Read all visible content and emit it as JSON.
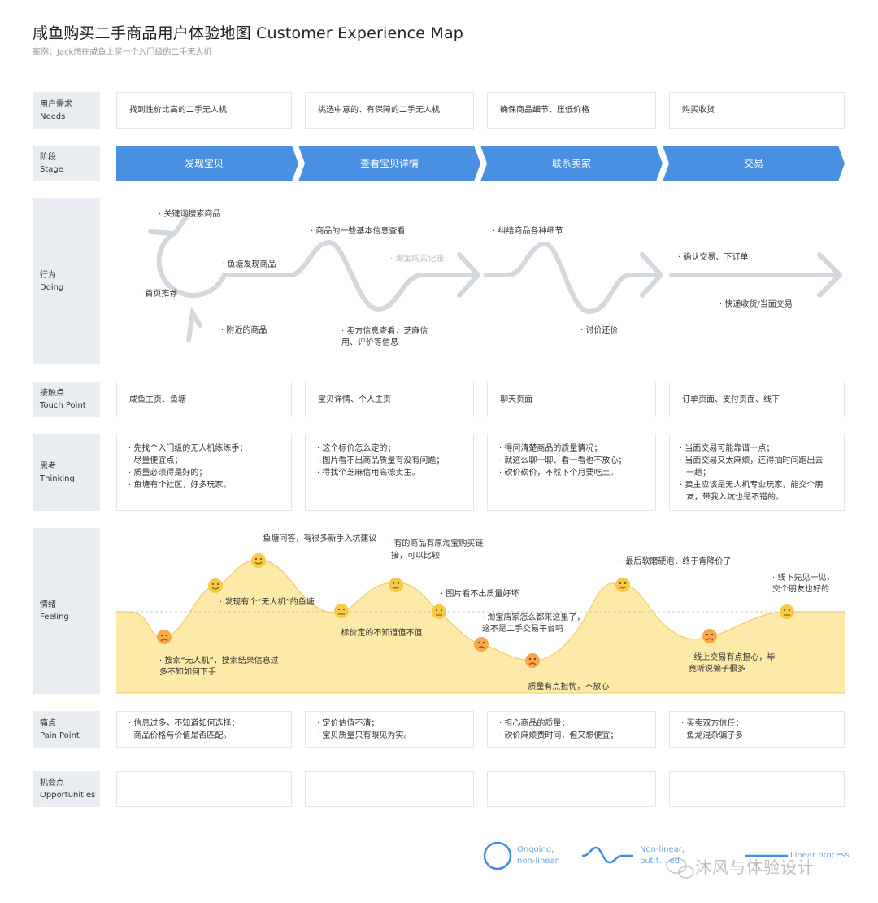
{
  "title": "咸鱼购买二手商品用户体验地图 Customer Experience Map",
  "subtitle": "案例：Jack想在咸鱼上买一个入门级的二手无人机",
  "rows": {
    "needs": {
      "zh": "用户需求",
      "en": "Needs"
    },
    "stage": {
      "zh": "阶段",
      "en": "Stage"
    },
    "doing": {
      "zh": "行为",
      "en": "Doing"
    },
    "touch": {
      "zh": "接触点",
      "en": "Touch Point"
    },
    "thinking": {
      "zh": "思考",
      "en": "Thinking"
    },
    "feeling": {
      "zh": "情绪",
      "en": "Feeling"
    },
    "pain": {
      "zh": "痛点",
      "en": "Pain Point"
    },
    "opp": {
      "zh": "机会点",
      "en": "Opportunities"
    }
  },
  "needs": [
    "找到性价比高的二手无人机",
    "挑选中意的、有保障的二手无人机",
    "确保商品细节、压低价格",
    "购买收货"
  ],
  "stages": [
    "发现宝贝",
    "查看宝贝详情",
    "联系卖家",
    "交易"
  ],
  "doing": {
    "d1": "· 关键词搜索商品",
    "d2": "· 鱼塘发现商品",
    "d3": "· 首页推荐",
    "d4": "· 附近的商品",
    "d5": "· 商品的一些基本信息查看",
    "d6": "· 淘宝购买记录",
    "d7a": "· 卖方信息查看，芝麻信",
    "d7b": "用、评价等信息",
    "d8": "· 纠结商品各种细节",
    "d9": "· 讨价还价",
    "d10": "· 确认交易、下订单",
    "d11": "· 快递收货/当面交易"
  },
  "touch": [
    "咸鱼主页、鱼塘",
    "宝贝详情、个人主页",
    "聊天页面",
    "订单页面、支付页面、线下"
  ],
  "thinking": [
    [
      "· 先找个入门级的无人机练练手；",
      "· 尽量便宜点；",
      "· 质量必须得是好的；",
      "· 鱼塘有个社区，好多玩家。"
    ],
    [
      "· 这个标价怎么定的；",
      "· 图片看不出商品质量有没有问题；",
      "· 得找个芝麻信用高德卖主。"
    ],
    [
      "· 得问清楚商品的质量情况；",
      "· 就这么聊一聊、看一看也不放心；",
      "· 砍价砍价，不然下个月要吃土。"
    ],
    [
      "· 当面交易可能靠谱一点；",
      "· 当面交易又太麻烦，还得抽时间跑出去",
      "一趟；",
      "· 卖主应该是无人机专业玩家，能交个朋",
      "友，带我入坑也是不错的。"
    ]
  ],
  "feeling": {
    "f1a": "· 搜索“无人机”，搜索结果信息过",
    "f1b": "多不知如何下手",
    "f2": "· 发现有个“无人机”的鱼塘",
    "f3": "· 鱼塘问答，有很多新手入坑建议",
    "f4": "· 标价定的不知道值不值",
    "f5a": "· 有的商品有原淘宝购买链",
    "f5b": "接，可以比较",
    "f6": "· 图片看不出质量好坏",
    "f7a": "· 淘宝店家怎么都来这里了，",
    "f7b": "这不是二手交易平台吗",
    "f8": "· 质量有点担忧，不放心",
    "f9": "· 最后软磨硬泡，终于肯降价了",
    "f10a": "· 线上交易有点担心，毕",
    "f10b": "竟听说骗子很多",
    "f11a": "· 线下先见一见，",
    "f11b": "交个朋友也好的"
  },
  "pain": [
    [
      "· 信息过多，不知道如何选择；",
      "· 商品价格与价值是否匹配。"
    ],
    [
      "· 定价估值不清；",
      "· 宝贝质量只有眼见为实。"
    ],
    [
      "· 担心商品的质量；",
      "· 砍价麻烦费时间，但又想便宜；"
    ],
    [
      "· 买卖双方信任；",
      "· 鱼龙混杂骗子多"
    ]
  ],
  "legend": {
    "ongoing_a": "Ongoing,",
    "ongoing_b": "non-linear",
    "nonlinear_a": "Non-linear,",
    "nonlinear_b": "but t... ed",
    "linear": "Linear process"
  },
  "watermark": "沐风与体验设计",
  "colors": {
    "stage_blue": "#4a90e2",
    "label_bg": "#e9edf2",
    "arrow_gray": "#d3d7de",
    "feeling_fill": "#fde9a8",
    "feeling_stroke": "#f4c96a",
    "face": "#f7c948",
    "legend_blue": "#3d8ee6"
  }
}
